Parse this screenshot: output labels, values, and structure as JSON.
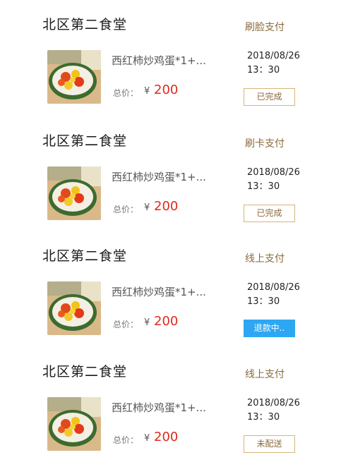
{
  "orders": [
    {
      "canteen": "北区第二食堂",
      "payment_method": "刷脸支付",
      "dish": "西红柿炒鸡蛋*1+...",
      "total_label": "总价：",
      "currency": "¥",
      "price": "200",
      "date": "2018/08/26",
      "time": "13：30",
      "status": "已完成"
    },
    {
      "canteen": "北区第二食堂",
      "payment_method": "刷卡支付",
      "dish": "西红柿炒鸡蛋*1+...",
      "total_label": "总价：",
      "currency": "¥",
      "price": "200",
      "date": "2018/08/26",
      "time": "13：30",
      "status": "已完成"
    },
    {
      "canteen": "北区第二食堂",
      "payment_method": "线上支付",
      "dish": "西红柿炒鸡蛋*1+...",
      "total_label": "总价：",
      "currency": "¥",
      "price": "200",
      "date": "2018/08/26",
      "time": "13：30",
      "status": "退款中.."
    },
    {
      "canteen": "北区第二食堂",
      "payment_method": "线上支付",
      "dish": "西红柿炒鸡蛋*1+...",
      "total_label": "总价：",
      "currency": "¥",
      "price": "200",
      "date": "2018/08/26",
      "time": "13：30",
      "status": "未配送"
    }
  ],
  "colors": {
    "price": "#e02a1c",
    "accent": "#d9b37a",
    "refund": "#2ea7f2"
  }
}
